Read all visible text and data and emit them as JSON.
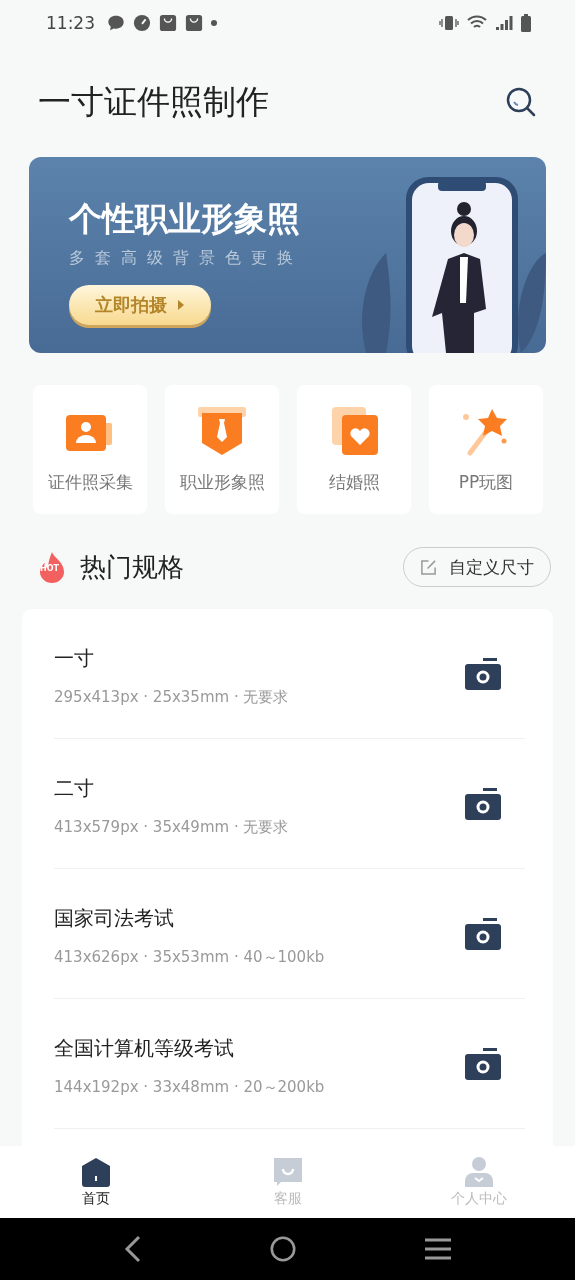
{
  "status_bar": {
    "time": "11:23"
  },
  "header": {
    "title": "一寸证件照制作"
  },
  "banner": {
    "title": "个性职业形象照",
    "subtitle": "多套高级背景色更换",
    "button": "立即拍摄"
  },
  "shortcuts": [
    {
      "label": "证件照采集",
      "kind": "id-photo"
    },
    {
      "label": "职业形象照",
      "kind": "tie"
    },
    {
      "label": "结婚照",
      "kind": "heart"
    },
    {
      "label": "PP玩图",
      "kind": "wand"
    }
  ],
  "hot": {
    "badge": "HOT",
    "title": "热门规格",
    "custom_button": "自定义尺寸"
  },
  "specs": [
    {
      "name": "一寸",
      "detail": "295x413px · 25x35mm · 无要求"
    },
    {
      "name": "二寸",
      "detail": "413x579px · 35x49mm · 无要求"
    },
    {
      "name": "国家司法考试",
      "detail": "413x626px · 35x53mm · 40～100kb"
    },
    {
      "name": "全国计算机等级考试",
      "detail": "144x192px · 33x48mm · 20～200kb"
    }
  ],
  "tabs": [
    {
      "label": "首页",
      "kind": "home",
      "selected": true
    },
    {
      "label": "客服",
      "kind": "chat",
      "selected": false
    },
    {
      "label": "个人中心",
      "kind": "person",
      "selected": false
    }
  ]
}
